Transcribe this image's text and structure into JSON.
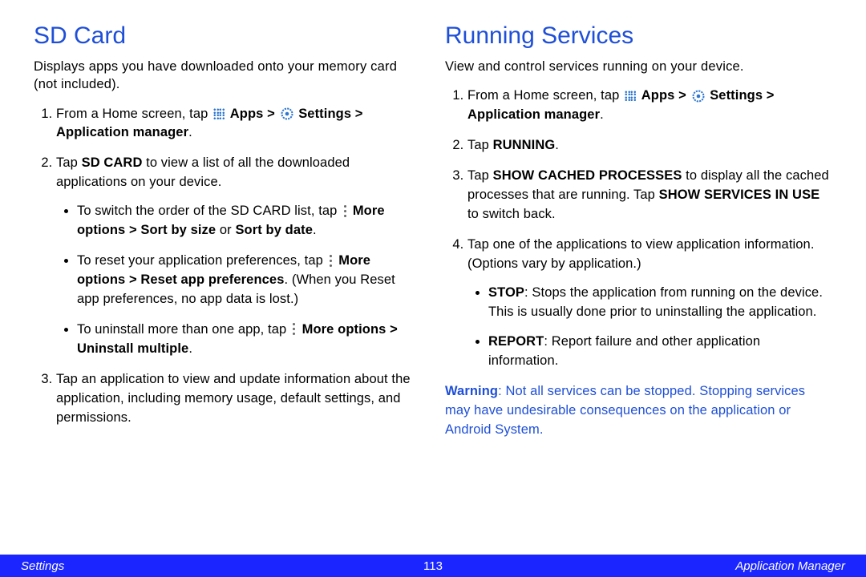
{
  "left": {
    "heading": "SD Card",
    "intro": "Displays apps you have downloaded onto your memory card (not included).",
    "step1_pre": "From a Home screen, tap ",
    "step1_apps": "Apps",
    "step1_gt1": " > ",
    "step1_settings": "Settings",
    "step1_gt2": " > ",
    "step1_appmgr": "Application manager",
    "step1_period": ".",
    "step2_a": "Tap ",
    "step2_b": "SD CARD",
    "step2_c": " to view a list of all the downloaded applications on your device.",
    "bul1_a": "To switch the order of the SD CARD list, tap ",
    "bul1_b": "More options > Sort by size",
    "bul1_c": " or ",
    "bul1_d": "Sort by date",
    "bul1_e": ".",
    "bul2_a": "To reset your application preferences, tap ",
    "bul2_b": "More options > Reset app preferences",
    "bul2_c": ". (When you Reset app preferences, no app data is lost.)",
    "bul3_a": "To uninstall more than one app, tap ",
    "bul3_b": "More options > Uninstall multiple",
    "bul3_c": ".",
    "step3": "Tap an application to view and update information about the application, including memory usage, default settings, and permissions."
  },
  "right": {
    "heading": "Running Services",
    "intro": "View and control services running on your device.",
    "step1_pre": "From a Home screen, tap ",
    "step1_apps": "Apps",
    "step1_gt1": " > ",
    "step1_settings": "Settings",
    "step1_gt2": " > ",
    "step1_appmgr": "Application manager",
    "step1_period": ".",
    "step2_a": "Tap ",
    "step2_b": "RUNNING",
    "step2_c": ".",
    "step3_a": "Tap ",
    "step3_b": "SHOW CACHED PROCESSES",
    "step3_c": " to display all the cached processes that are running. Tap ",
    "step3_d": "SHOW SERVICES IN USE",
    "step3_e": " to switch back.",
    "step4": "Tap one of the applications to view application information. (Options vary by application.)",
    "bul1_a": "STOP",
    "bul1_b": ": Stops the application from running on the device. This is usually done prior to uninstalling the application.",
    "bul2_a": "REPORT",
    "bul2_b": ": Report failure and other application information.",
    "warn_a": "Warning",
    "warn_b": ": Not all services can be stopped. Stopping services may have undesirable consequences on the application or Android System."
  },
  "footer": {
    "left": "Settings",
    "center": "113",
    "right": "Application Manager"
  }
}
